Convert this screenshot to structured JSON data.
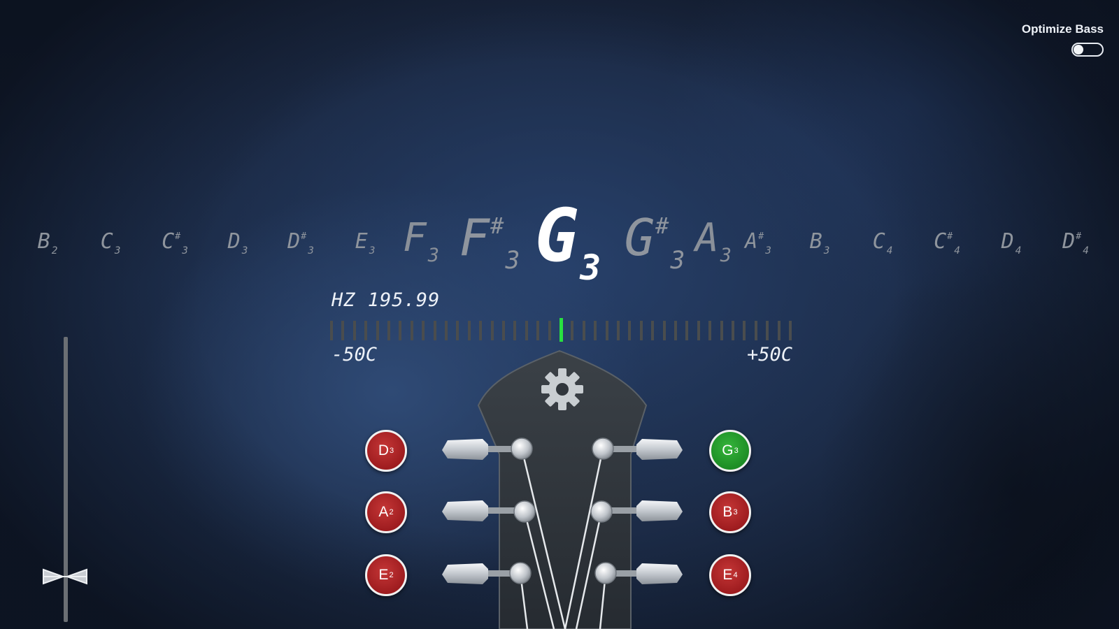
{
  "header": {
    "optimize_bass_label": "Optimize Bass",
    "optimize_bass_on": false
  },
  "note_strip": [
    {
      "n": "B",
      "o": "2",
      "sharp": false,
      "size": "small"
    },
    {
      "n": "C",
      "o": "3",
      "sharp": false,
      "size": "small"
    },
    {
      "n": "C",
      "o": "3",
      "sharp": true,
      "size": "small"
    },
    {
      "n": "D",
      "o": "3",
      "sharp": false,
      "size": "small"
    },
    {
      "n": "D",
      "o": "3",
      "sharp": true,
      "size": "small"
    },
    {
      "n": "E",
      "o": "3",
      "sharp": false,
      "size": "small"
    },
    {
      "n": "F",
      "o": "3",
      "sharp": false,
      "size": "medium"
    },
    {
      "n": "F",
      "o": "3",
      "sharp": true,
      "size": "large"
    },
    {
      "n": "G",
      "o": "3",
      "sharp": false,
      "size": "active"
    },
    {
      "n": "G",
      "o": "3",
      "sharp": true,
      "size": "large"
    },
    {
      "n": "A",
      "o": "3",
      "sharp": false,
      "size": "medium"
    },
    {
      "n": "A",
      "o": "3",
      "sharp": true,
      "size": "small"
    },
    {
      "n": "B",
      "o": "3",
      "sharp": false,
      "size": "small"
    },
    {
      "n": "C",
      "o": "4",
      "sharp": false,
      "size": "small"
    },
    {
      "n": "C",
      "o": "4",
      "sharp": true,
      "size": "small"
    },
    {
      "n": "D",
      "o": "4",
      "sharp": false,
      "size": "small"
    },
    {
      "n": "D",
      "o": "4",
      "sharp": true,
      "size": "small"
    }
  ],
  "tuner": {
    "hz_label": "HZ 195.99",
    "cents_min_label": "-50C",
    "cents_max_label": "+50C",
    "cents_offset": 0,
    "needle_color": "#28e040"
  },
  "strings": {
    "left": [
      {
        "note": "D",
        "octave": "3",
        "state": "red"
      },
      {
        "note": "A",
        "octave": "2",
        "state": "red"
      },
      {
        "note": "E",
        "octave": "2",
        "state": "red"
      }
    ],
    "right": [
      {
        "note": "G",
        "octave": "3",
        "state": "green"
      },
      {
        "note": "B",
        "octave": "3",
        "state": "red"
      },
      {
        "note": "E",
        "octave": "4",
        "state": "red"
      }
    ]
  },
  "icons": {
    "settings": "gear-icon",
    "input_level": "input-level-slider"
  },
  "colors": {
    "string_red": "#9e1c1f",
    "string_green": "#1d8d25",
    "active_note": "#ffffff",
    "inactive_note": "#9ea4ad"
  }
}
